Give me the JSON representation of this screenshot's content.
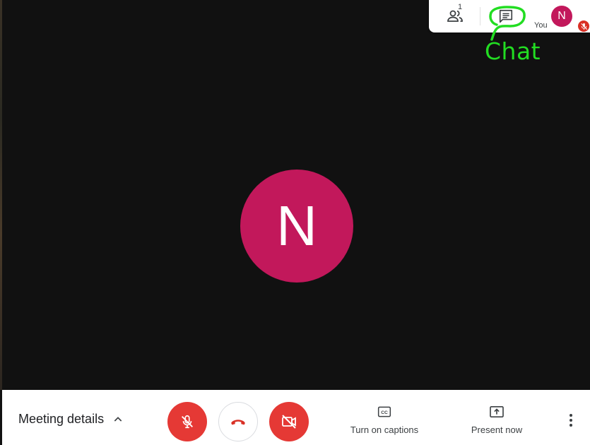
{
  "topbar": {
    "participants_count": "1",
    "self_initial": "N",
    "self_label": "You"
  },
  "annotation": {
    "text": "Chat",
    "color": "#22dd22"
  },
  "main": {
    "avatar_initial": "N"
  },
  "controls": {
    "meeting_details_label": "Meeting details",
    "captions_label": "Turn on captions",
    "present_label": "Present now"
  },
  "colors": {
    "avatar": "#c2185b",
    "danger": "#e53935",
    "background": "#111111"
  },
  "icons": [
    "people-icon",
    "chat-icon",
    "mic-off-icon",
    "hangup-icon",
    "camera-off-icon",
    "captions-icon",
    "present-icon",
    "more-vert-icon",
    "chevron-up-icon"
  ]
}
